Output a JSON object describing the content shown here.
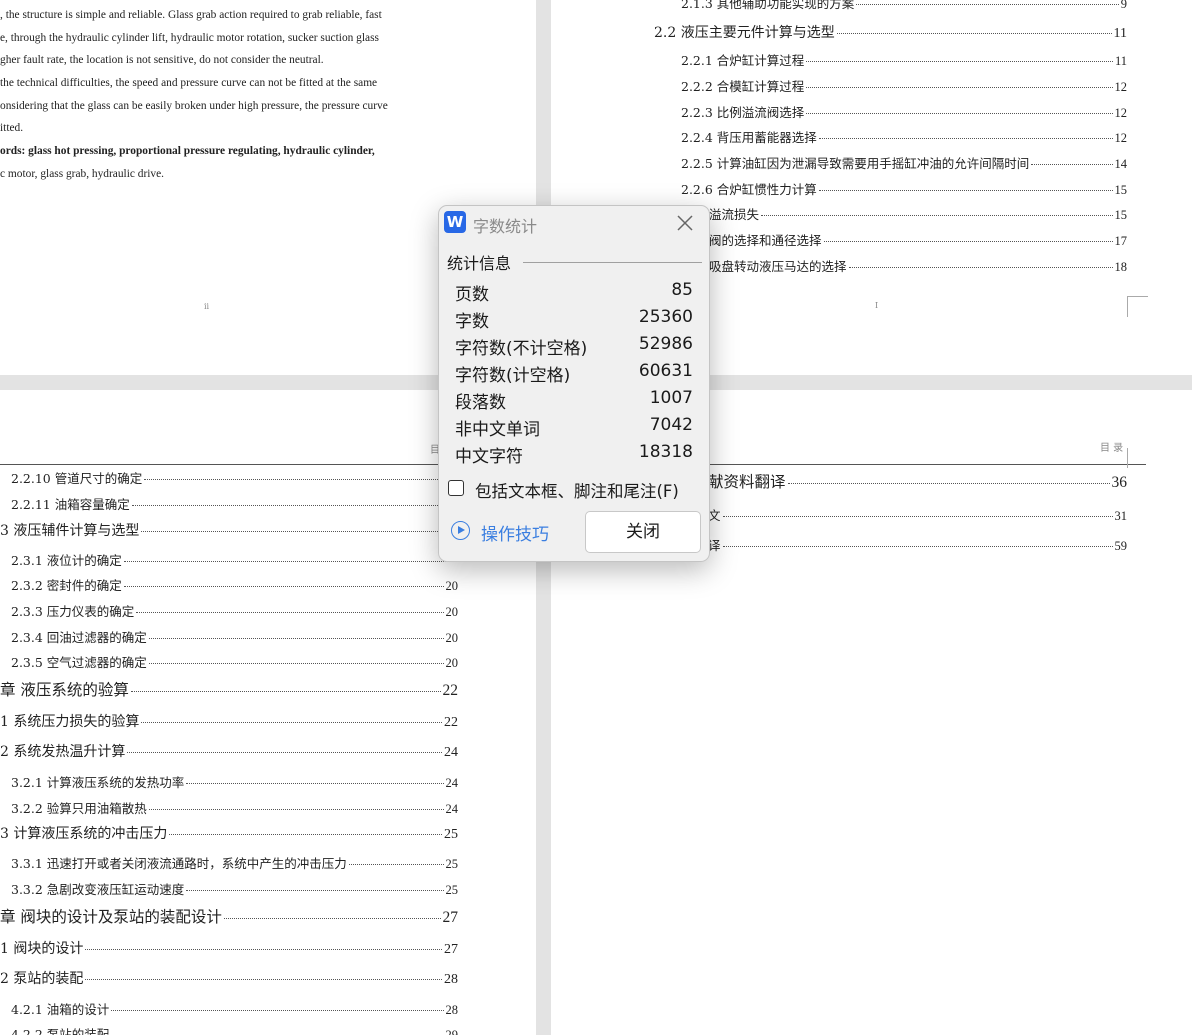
{
  "page_tl": {
    "lines": [
      ", the structure is simple and reliable. Glass grab action required to grab reliable, fast",
      "e, through the hydraulic cylinder lift, hydraulic motor rotation, sucker suction glass",
      "gher fault rate, the location is not sensitive, do not consider the neutral.",
      " the technical difficulties, the speed and pressure curve can not be fitted at the same",
      "onsidering that the glass can be easily broken under high pressure, the pressure curve",
      "itted.",
      "ords:    glass hot pressing, proportional pressure regulating, hydraulic cylinder,",
      "c motor, glass grab, hydraulic drive."
    ],
    "page_number": "ii"
  },
  "page_tr": {
    "entries": [
      {
        "title": "2.1.3  其他辅助功能实现的方案",
        "page": "9"
      },
      {
        "title": "2.2 液压主要元件计算与选型",
        "page": "11"
      },
      {
        "title": "2.2.1 合炉缸计算过程",
        "page": "11"
      },
      {
        "title": "2.2.2 合模缸计算过程",
        "page": "12"
      },
      {
        "title": "2.2.3 比例溢流阀选择",
        "page": "12"
      },
      {
        "title": "2.2.4 背压用蓄能器选择",
        "page": "12"
      },
      {
        "title": "2.2.5 计算油缸因为泄漏导致需要用手摇缸冲油的允许间隔时间",
        "page": "14"
      },
      {
        "title": "2.2.6 合炉缸惯性力计算",
        "page": "15"
      },
      {
        "title": "溢流损失",
        "page": "15"
      },
      {
        "title": "阀的选择和通径选择",
        "page": "17"
      },
      {
        "title": "吸盘转动液压马达的选择",
        "page": "18"
      }
    ],
    "page_number": "I"
  },
  "page_bl": {
    "header": "目",
    "entries": [
      {
        "title": "2.2.10 管道尺寸的确定",
        "page": ""
      },
      {
        "title": "2.2.11 油箱容量确定",
        "page": ""
      },
      {
        "title": "3  液压辅件计算与选型",
        "page": ""
      },
      {
        "title": "2.3.1 液位计的确定",
        "page": ""
      },
      {
        "title": "2.3.2  密封件的确定",
        "page": "20"
      },
      {
        "title": "2.3.3  压力仪表的确定",
        "page": "20"
      },
      {
        "title": "2.3.4  回油过滤器的确定",
        "page": "20"
      },
      {
        "title": "2.3.5  空气过滤器的确定",
        "page": "20"
      },
      {
        "title": "章  液压系统的验算",
        "page": "22"
      },
      {
        "title": "1  系统压力损失的验算",
        "page": "22"
      },
      {
        "title": "2 系统发热温升计算",
        "page": "24"
      },
      {
        "title": "3.2.1 计算液压系统的发热功率",
        "page": "24"
      },
      {
        "title": "3.2.2 验算只用油箱散热",
        "page": "24"
      },
      {
        "title": "3  计算液压系统的冲击压力",
        "page": "25"
      },
      {
        "title": "3.3.1 迅速打开或者关闭液流通路时，系统中产生的冲击压力",
        "page": "25"
      },
      {
        "title": "3.3.2 急剧改变液压缸运动速度",
        "page": "25"
      },
      {
        "title": "章  阀块的设计及泵站的装配设计",
        "page": "27"
      },
      {
        "title": "1  阀块的设计",
        "page": "27"
      },
      {
        "title": "2  泵站的装配",
        "page": "28"
      },
      {
        "title": "4.2.1  油箱的设计",
        "page": "28"
      },
      {
        "title": "4.2.2  泵站的装配",
        "page": "29"
      }
    ]
  },
  "page_br": {
    "header": "目 录",
    "entries": [
      {
        "title": "献资料翻译",
        "page": "36"
      },
      {
        "title": "文",
        "page": "31"
      },
      {
        "title": "译",
        "page": "59"
      }
    ]
  },
  "dialog": {
    "logo": "W",
    "title": "字数统计",
    "section": "统计信息",
    "stats": [
      {
        "label": "页数",
        "value": "85"
      },
      {
        "label": "字数",
        "value": "25360"
      },
      {
        "label": "字符数(不计空格)",
        "value": "52986"
      },
      {
        "label": "字符数(计空格)",
        "value": "60631"
      },
      {
        "label": "段落数",
        "value": "1007"
      },
      {
        "label": "非中文单词",
        "value": "7042"
      },
      {
        "label": "中文字符",
        "value": "18318"
      }
    ],
    "checkbox_label": "包括文本框、脚注和尾注(F)",
    "checkbox_checked": false,
    "tips_label": "操作技巧",
    "close_label": "关闭",
    "accent_color": "#3a7ee0",
    "logo_color": "#2868e6"
  }
}
